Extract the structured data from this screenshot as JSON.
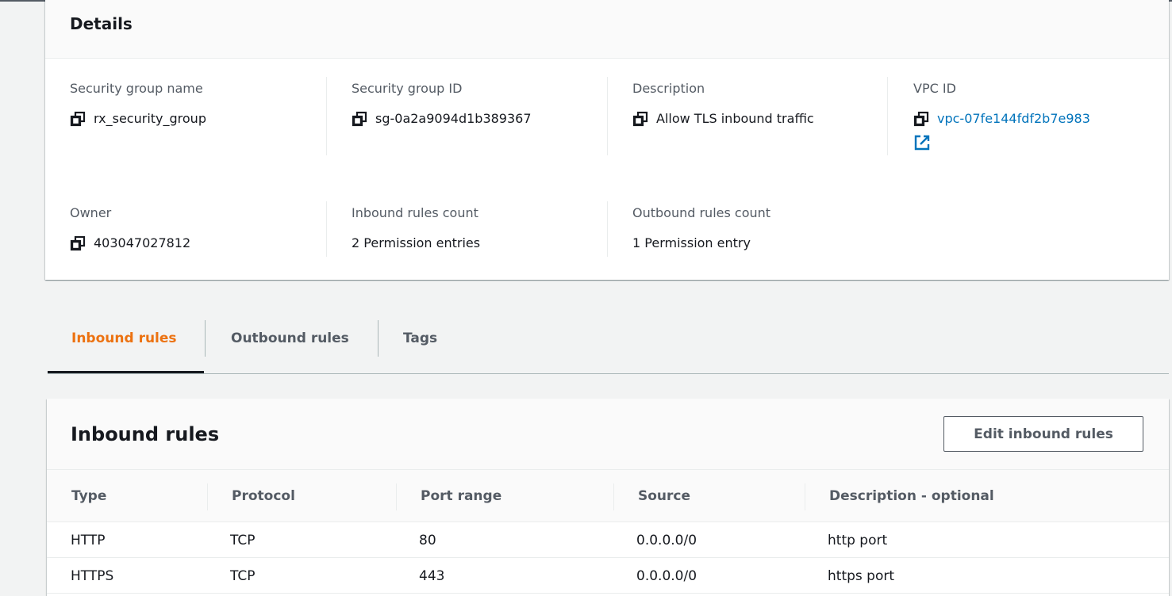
{
  "details": {
    "title": "Details",
    "fields": [
      {
        "label": "Security group name",
        "value": "rx_security_group",
        "copyable": true
      },
      {
        "label": "Security group ID",
        "value": "sg-0a2a9094d1b389367",
        "copyable": true
      },
      {
        "label": "Description",
        "value": "Allow TLS inbound traffic",
        "copyable": true
      },
      {
        "label": "VPC ID",
        "value": "vpc-07fe144fdf2b7e983",
        "copyable": true,
        "link": true,
        "external_icon": "external-link-icon"
      },
      {
        "label": "Owner",
        "value": "403047027812",
        "copyable": true
      },
      {
        "label": "Inbound rules count",
        "value": "2 Permission entries",
        "copyable": false
      },
      {
        "label": "Outbound rules count",
        "value": "1 Permission entry",
        "copyable": false
      }
    ]
  },
  "tabs": [
    {
      "label": "Inbound rules",
      "active": true
    },
    {
      "label": "Outbound rules",
      "active": false
    },
    {
      "label": "Tags",
      "active": false
    }
  ],
  "inbound_rules": {
    "title": "Inbound rules",
    "edit_button_label": "Edit inbound rules",
    "columns": [
      "Type",
      "Protocol",
      "Port range",
      "Source",
      "Description - optional"
    ],
    "rows": [
      [
        "HTTP",
        "TCP",
        "80",
        "0.0.0.0/0",
        "http port"
      ],
      [
        "HTTPS",
        "TCP",
        "443",
        "0.0.0.0/0",
        "https port"
      ]
    ]
  },
  "colors": {
    "accent_active_tab": "#ec7211",
    "link": "#0073bb",
    "text": "#16191f",
    "label_text": "#545b64"
  },
  "icons": {
    "copy": "copy-icon",
    "external_link": "external-link-icon"
  }
}
